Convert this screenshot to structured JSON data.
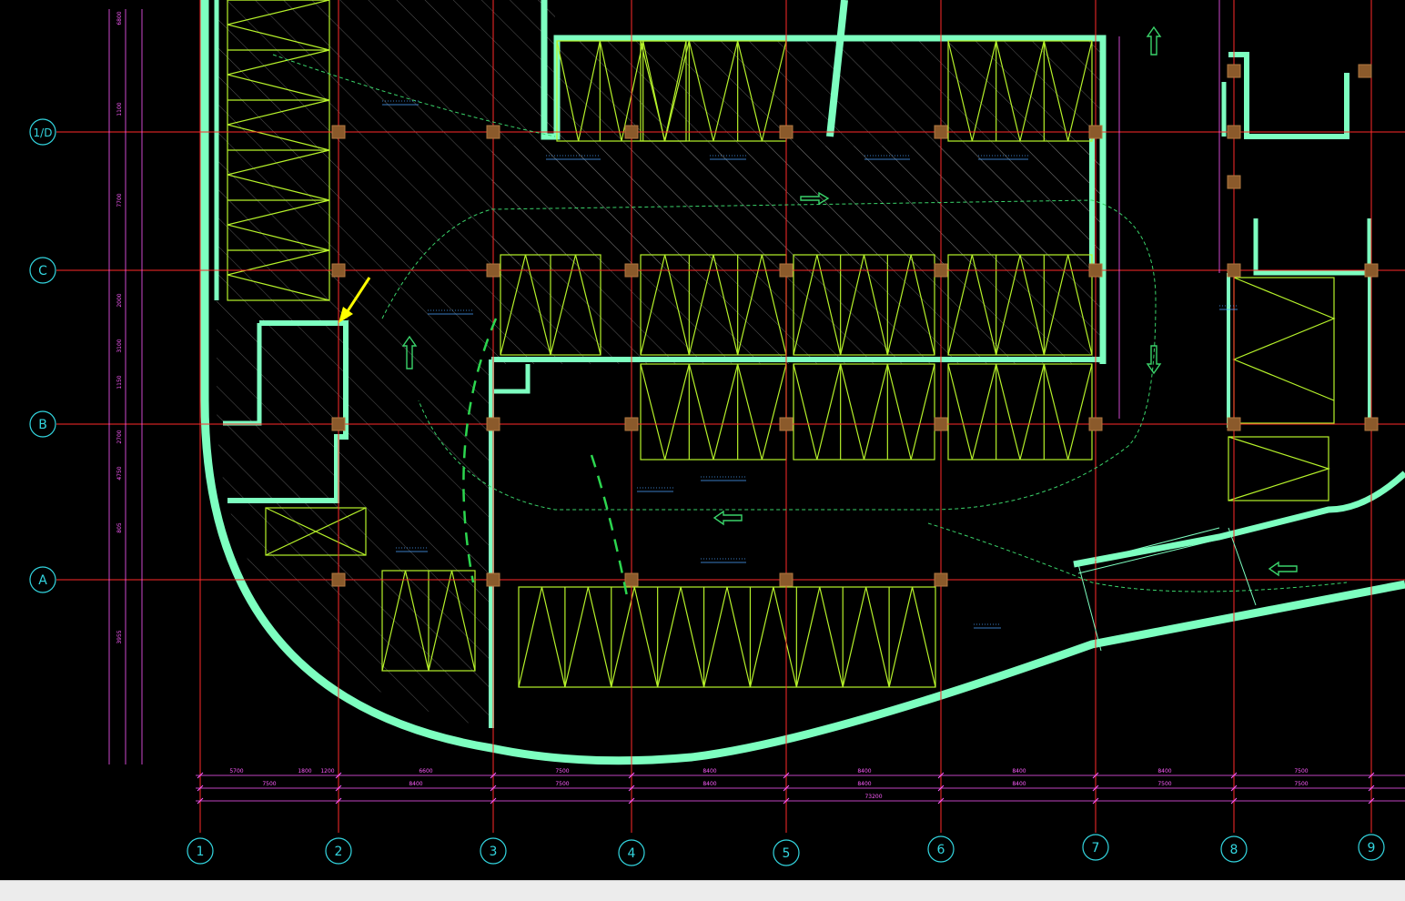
{
  "drawing": {
    "row_axes": [
      {
        "id": "row-axis-1d",
        "label": "1/D"
      },
      {
        "id": "row-axis-c",
        "label": "C"
      },
      {
        "id": "row-axis-b",
        "label": "B"
      },
      {
        "id": "row-axis-a",
        "label": "A"
      }
    ],
    "column_axes": [
      {
        "id": "col-axis-1",
        "label": "1"
      },
      {
        "id": "col-axis-2",
        "label": "2"
      },
      {
        "id": "col-axis-3",
        "label": "3"
      },
      {
        "id": "col-axis-4",
        "label": "4"
      },
      {
        "id": "col-axis-5",
        "label": "5"
      },
      {
        "id": "col-axis-6",
        "label": "6"
      },
      {
        "id": "col-axis-7",
        "label": "7"
      },
      {
        "id": "col-axis-8",
        "label": "8"
      },
      {
        "id": "col-axis-9",
        "label": "9"
      }
    ],
    "bay_dimensions": [
      "5700",
      "1800",
      "1200",
      "6600",
      "7500",
      "8400",
      "8400",
      "8400",
      "8400",
      "7500",
      "7500"
    ],
    "sub_dimensions": [
      "7500",
      "8400",
      "7500",
      "8400",
      "8400",
      "8400",
      "7500",
      "7500"
    ],
    "total_dimension": "73200",
    "left_dimensions": [
      "6800",
      "1100",
      "7700",
      "2000",
      "3100",
      "1150",
      "2700",
      "4750",
      "805",
      "3955"
    ],
    "colors": {
      "background": "#000000",
      "axis_line": "#ff2a2a",
      "axis_bubble": "#33d6e0",
      "wall": "#7dffc0",
      "parking": "#b6f22a",
      "hatch": "#8a8a8a",
      "dimension": "#ff5cff",
      "annotation": "#4aa3ff",
      "marker": "#ffff00",
      "column": "#8b5a2b"
    }
  },
  "statusbar": {
    "text": ""
  }
}
